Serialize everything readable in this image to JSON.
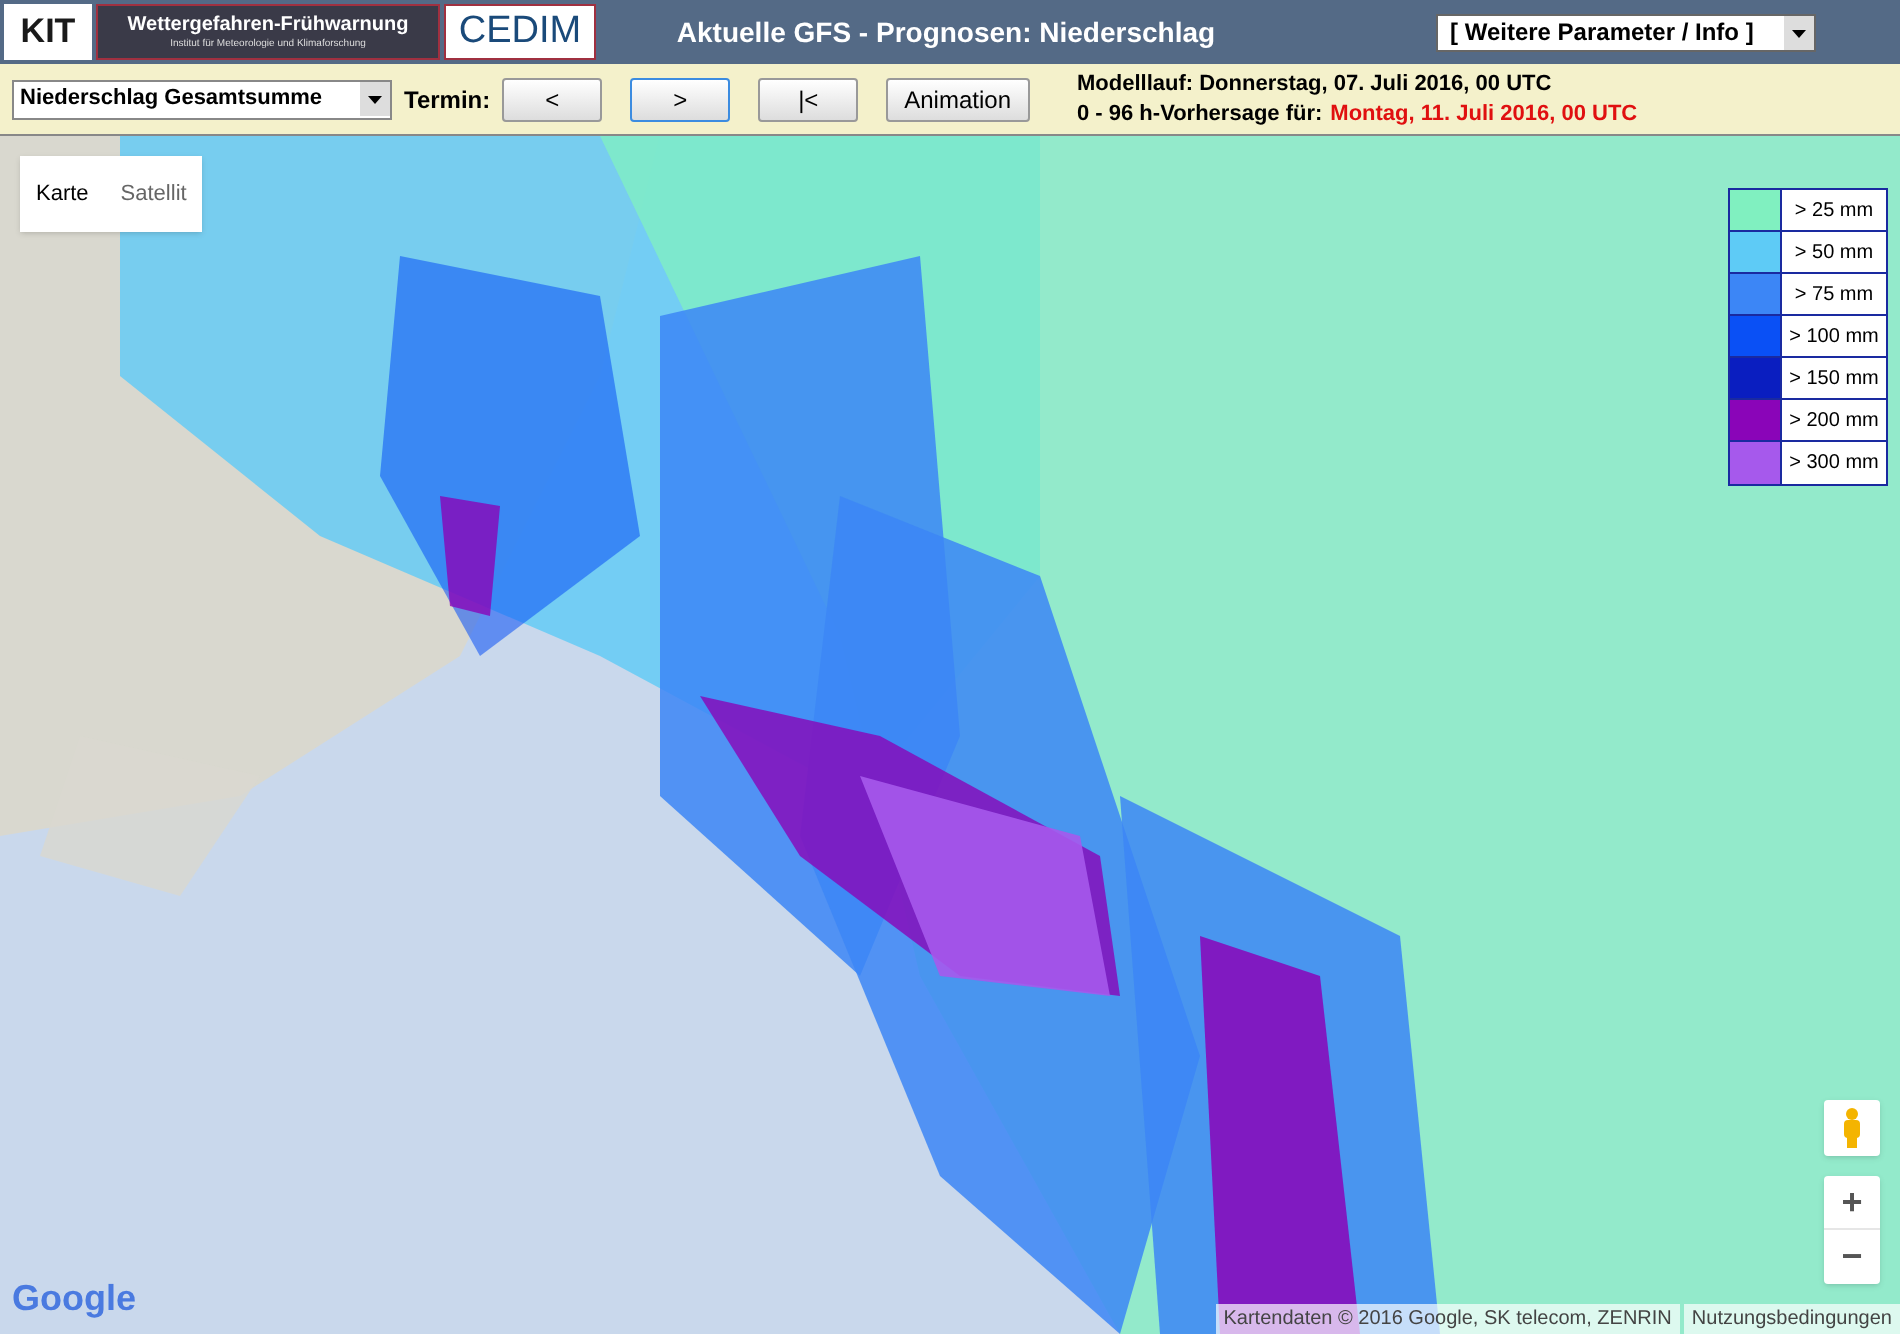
{
  "header": {
    "logos": {
      "kit": "KIT",
      "banner_title": "Wettergefahren-Frühwarnung",
      "banner_subtitle": "Institut für Meteorologie und Klimaforschung",
      "cedim": "CEDIM"
    },
    "title": "Aktuelle GFS - Prognosen: Niederschlag",
    "menu": "[ Weitere Parameter / Info ]"
  },
  "toolbar": {
    "parameter": "Niederschlag Gesamtsumme",
    "termin_label": "Termin:",
    "termin_buttons": [
      {
        "label": "<",
        "selected": false
      },
      {
        "label": ">",
        "selected": true
      },
      {
        "label": "|<",
        "selected": false
      }
    ],
    "animation": "Animation",
    "modelllauf": "Modelllauf: Donnerstag, 07. Juli 2016, 00 UTC",
    "vorhersage_label": "0 - 96 h-Vorhersage für:",
    "vorhersage_date": "Montag, 11. Juli 2016, 00 UTC"
  },
  "map": {
    "map_types": [
      {
        "label": "Karte",
        "selected": true
      },
      {
        "label": "Satellit",
        "selected": false
      }
    ],
    "legend": [
      {
        "label": "> 25 mm",
        "color": "#80f0c0"
      },
      {
        "label": "> 50 mm",
        "color": "#5ecbf6"
      },
      {
        "label": "> 75 mm",
        "color": "#3c86f6"
      },
      {
        "label": "> 100 mm",
        "color": "#0a50f5"
      },
      {
        "label": "> 150 mm",
        "color": "#0a1ec0"
      },
      {
        "label": "> 200 mm",
        "color": "#8a05b8"
      },
      {
        "label": "> 300 mm",
        "color": "#a659ec"
      }
    ],
    "zoom_in": "+",
    "zoom_out": "−",
    "logo": "Google",
    "attribution": "Kartendaten © 2016 Google, SK telecom, ZENRIN",
    "terms": "Nutzungsbedingungen"
  }
}
